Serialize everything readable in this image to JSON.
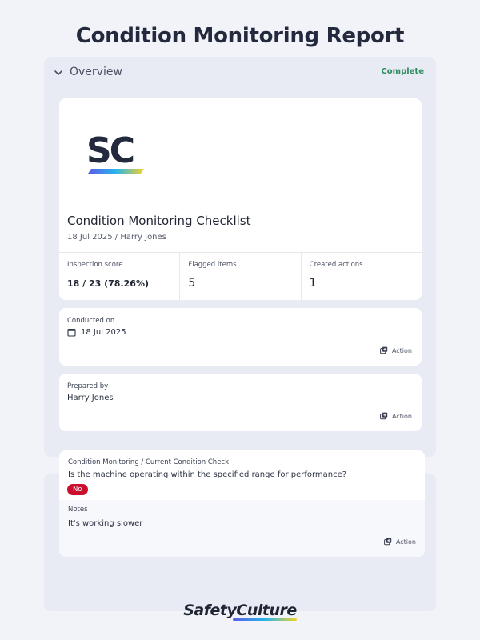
{
  "page": {
    "title": "Condition Monitoring Report"
  },
  "overview": {
    "label": "Overview",
    "status": "Complete",
    "logo": {
      "icon": "safetyculture-sc-logo",
      "text": "SC"
    }
  },
  "checklist": {
    "title": "Condition Monitoring Checklist",
    "subtitle": "18 Jul 2025 / Harry Jones"
  },
  "stats": [
    {
      "label": "Inspection score",
      "value": "18 / 23 (78.26%)"
    },
    {
      "label": "Flagged items",
      "value": "5"
    },
    {
      "label": "Created actions",
      "value": "1"
    }
  ],
  "conducted": {
    "label": "Conducted on",
    "value": "18 Jul 2025",
    "icon": "calendar-icon",
    "action_label": "Action"
  },
  "prepared": {
    "label": "Prepared by",
    "value": "Harry Jones",
    "action_label": "Action"
  },
  "question": {
    "path": "Condition Monitoring / Current Condition Check",
    "text": "Is the machine operating within the specified range for performance?",
    "answer": "No",
    "answer_color": "#c8102e",
    "notes_label": "Notes",
    "notes_value": "It's working slower",
    "action_label": "Action"
  },
  "footer": {
    "brand": "SafetyCulture"
  },
  "colors": {
    "accent_green": "#2e8a5f",
    "panel_bg": "#e8eaf4",
    "brand_gradient": [
      "#5b5de8",
      "#27b5ec",
      "#f2d32c"
    ]
  }
}
